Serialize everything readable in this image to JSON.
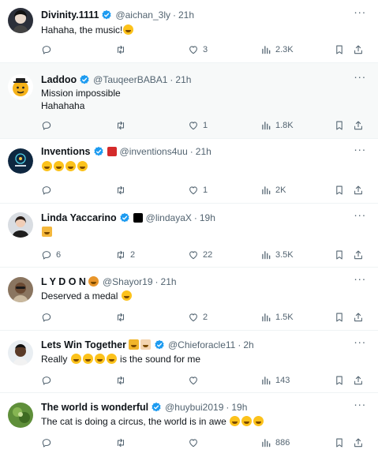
{
  "tweets": [
    {
      "name": "Divinity.1111",
      "handle": "@aichan_3ly",
      "dot": "·",
      "time": "21h",
      "text": "Hahaha, the music!",
      "reply_count": "",
      "retweet_count": "",
      "like_count": "3",
      "views": "2.3K"
    },
    {
      "name": "Laddoo",
      "handle": "@TauqeerBABA1",
      "dot": "·",
      "time": "21h",
      "text": "Mission impossible\nHahahaha",
      "reply_count": "",
      "retweet_count": "",
      "like_count": "1",
      "views": "1.8K"
    },
    {
      "name": "Inventions",
      "handle": "@inventions4uu",
      "dot": "·",
      "time": "21h",
      "text": "",
      "reply_count": "",
      "retweet_count": "",
      "like_count": "1",
      "views": "2K"
    },
    {
      "name": "Linda Yaccarino",
      "handle": "@lindayaX",
      "dot": "·",
      "time": "19h",
      "text": "",
      "reply_count": "6",
      "retweet_count": "2",
      "like_count": "22",
      "views": "3.5K"
    },
    {
      "name": "L Y D O N",
      "handle": "@Shayor19",
      "dot": "·",
      "time": "21h",
      "text": "Deserved a medal",
      "reply_count": "",
      "retweet_count": "",
      "like_count": "2",
      "views": "1.5K"
    },
    {
      "name": "Lets Win Together",
      "handle": "@Chieforacle11",
      "dot": "·",
      "time": "2h",
      "text_before": "Really",
      "text_after": "is the sound for me",
      "reply_count": "",
      "retweet_count": "",
      "like_count": "",
      "views": "143"
    },
    {
      "name": "The world is wonderful",
      "handle": "@huybui2019",
      "dot": "·",
      "time": "19h",
      "text": "The cat is doing a circus, the world is in awe",
      "reply_count": "",
      "retweet_count": "",
      "like_count": "",
      "views": "886"
    }
  ],
  "more_glyph": "···",
  "colors": {
    "verified": "#1d9bf0",
    "muted": "#536471",
    "text": "#0f1419",
    "divider": "#eff3f4",
    "highlight_bg": "#f7f9f9"
  },
  "icons": [
    "reply-icon",
    "retweet-icon",
    "like-icon",
    "views-icon",
    "bookmark-icon",
    "share-icon",
    "verified-badge-icon",
    "more-icon"
  ]
}
